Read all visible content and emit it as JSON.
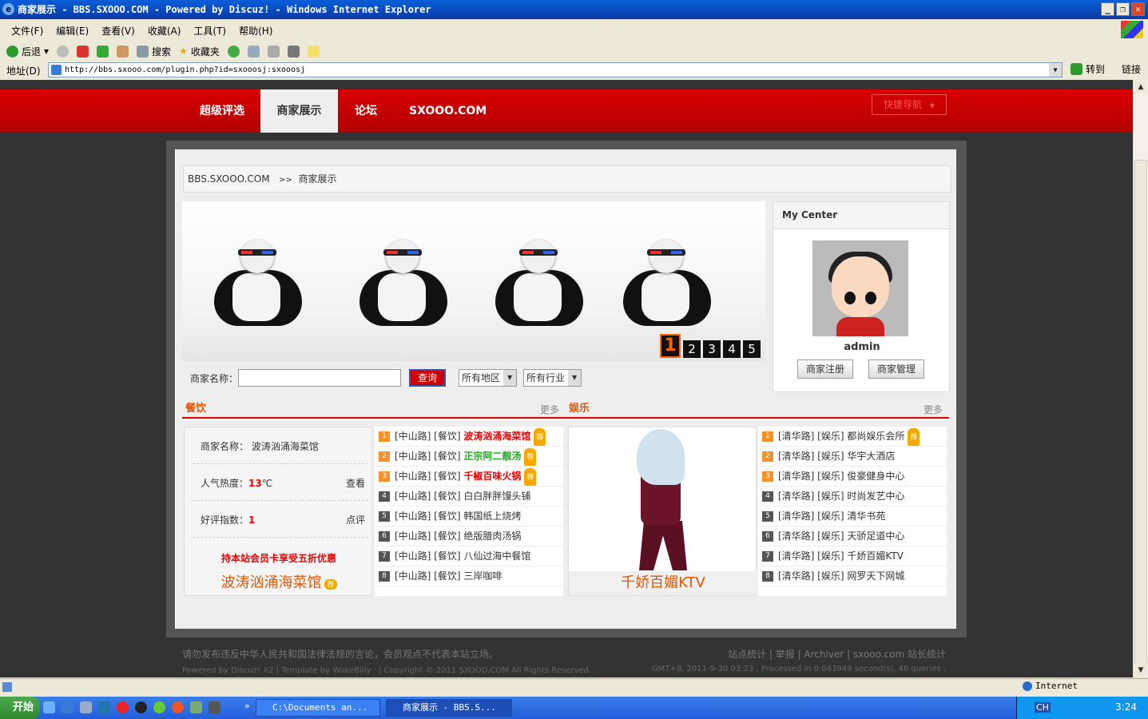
{
  "window": {
    "title": "商家展示 - BBS.SXOOO.COM - Powered by Discuz! - Windows Internet Explorer"
  },
  "menu": [
    "文件(F)",
    "编辑(E)",
    "查看(V)",
    "收藏(A)",
    "工具(T)",
    "帮助(H)"
  ],
  "toolbar": {
    "back": "后退",
    "search": "搜索",
    "favorites": "收藏夹"
  },
  "address": {
    "label": "地址(D)",
    "url": "http://bbs.sxooo.com/plugin.php?id=sxooosj:sxooosj",
    "go": "转到",
    "links": "链接"
  },
  "nav": {
    "items": [
      "超级评选",
      "商家展示",
      "论坛",
      "SXOOO.COM"
    ],
    "active": "商家展示",
    "quick": "快捷导航"
  },
  "breadcrumb": {
    "site": "BBS.SXOOO.COM",
    "sep": ">>",
    "current": "商家展示"
  },
  "banner": {
    "pages": [
      "1",
      "2",
      "3",
      "4",
      "5"
    ],
    "active_page": "1"
  },
  "search": {
    "label": "商家名称：",
    "button": "查询",
    "region": "所有地区",
    "industry": "所有行业"
  },
  "mycenter": {
    "title": "My Center",
    "username": "admin",
    "register": "商家注册",
    "manage": "商家管理"
  },
  "food": {
    "title": "餐饮",
    "more": "更多",
    "info": {
      "name_label": "商家名称：",
      "name": "波涛汹涌海菜馆",
      "heat_label": "人气热度：",
      "heat_value": "13",
      "heat_unit": "℃",
      "view": "查看",
      "rating_label": "好评指数：",
      "rating_value": "1",
      "comment": "点评",
      "promo": "持本站会员卡享受五折优惠",
      "shop": "波涛汹涌海菜馆"
    },
    "items": [
      {
        "n": "1",
        "prefix": "[中山路] [餐饮]",
        "name": "波涛汹涌海菜馆",
        "style": "red",
        "hot": true
      },
      {
        "n": "2",
        "prefix": "[中山路] [餐饮]",
        "name": "正宗阿二靓汤",
        "style": "grn",
        "hot": true
      },
      {
        "n": "3",
        "prefix": "[中山路] [餐饮]",
        "name": "千椒百味火锅",
        "style": "red",
        "hot": true
      },
      {
        "n": "4",
        "prefix": "[中山路] [餐饮]",
        "name": "白白胖胖馒头铺",
        "style": "",
        "hot": false
      },
      {
        "n": "5",
        "prefix": "[中山路] [餐饮]",
        "name": "韩国纸上烧烤",
        "style": "",
        "hot": false
      },
      {
        "n": "6",
        "prefix": "[中山路] [餐饮]",
        "name": "绝版腊肉汤锅",
        "style": "",
        "hot": false
      },
      {
        "n": "7",
        "prefix": "[中山路] [餐饮]",
        "name": "八仙过海中餐馆",
        "style": "",
        "hot": false
      },
      {
        "n": "8",
        "prefix": "[中山路] [餐饮]",
        "name": "三岸咖啡",
        "style": "",
        "hot": false
      }
    ]
  },
  "ent": {
    "title": "娱乐",
    "more": "更多",
    "featured": "千娇百媚KTV",
    "items": [
      {
        "n": "1",
        "prefix": "[清华路] [娱乐]",
        "name": "都尚娱乐会所",
        "hot": true
      },
      {
        "n": "2",
        "prefix": "[清华路] [娱乐]",
        "name": "华宇大酒店",
        "hot": false
      },
      {
        "n": "3",
        "prefix": "[清华路] [娱乐]",
        "name": "俊豪健身中心",
        "hot": false
      },
      {
        "n": "4",
        "prefix": "[清华路] [娱乐]",
        "name": "时尚发艺中心",
        "hot": false
      },
      {
        "n": "5",
        "prefix": "[清华路] [娱乐]",
        "name": "清华书苑",
        "hot": false
      },
      {
        "n": "6",
        "prefix": "[清华路] [娱乐]",
        "name": "天骄足道中心",
        "hot": false
      },
      {
        "n": "7",
        "prefix": "[清华路] [娱乐]",
        "name": "千娇百媚KTV",
        "hot": false
      },
      {
        "n": "8",
        "prefix": "[清华路] [娱乐]",
        "name": "网罗天下网城",
        "hot": false
      }
    ]
  },
  "hot_tag": "荐",
  "footer": {
    "notice": "请勿发布违反中华人民共和国法律法规的言论，会员观点不代表本站立场。",
    "links": "站点统计 | 举报 | Archiver | sxooo.com 站长统计",
    "powered": "Powered by Discuz! X2 | Template by WokeBilly · | Copyright © 2011 SXOOO.COM All Rights Reserved.",
    "stats": "GMT+8, 2011-9-30 03:23 , Processed in 0.043949 second(s), 48 queries ."
  },
  "status": {
    "zone": "Internet"
  },
  "taskbar": {
    "start": "开始",
    "tasks": [
      "C:\\Documents an...",
      "商家展示 - BBS.S..."
    ],
    "lang": "CH",
    "clock": "3:24"
  }
}
